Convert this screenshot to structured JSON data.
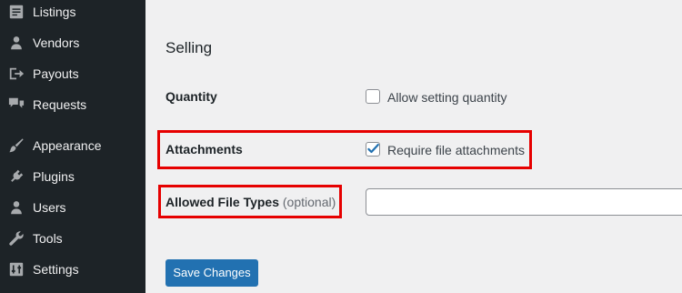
{
  "sidebar": {
    "items": [
      {
        "label": "Listings",
        "icon": "listings-icon"
      },
      {
        "label": "Vendors",
        "icon": "person-icon"
      },
      {
        "label": "Payouts",
        "icon": "payout-arrow-icon"
      },
      {
        "label": "Requests",
        "icon": "chat-bubbles-icon"
      },
      {
        "label": "Appearance",
        "icon": "paintbrush-icon"
      },
      {
        "label": "Plugins",
        "icon": "plug-icon"
      },
      {
        "label": "Users",
        "icon": "person-icon"
      },
      {
        "label": "Tools",
        "icon": "wrench-icon"
      },
      {
        "label": "Settings",
        "icon": "sliders-icon"
      }
    ]
  },
  "main": {
    "section_title": "Selling",
    "quantity": {
      "label": "Quantity",
      "checkbox_label": "Allow setting quantity",
      "checked": false
    },
    "attachments": {
      "label": "Attachments",
      "checkbox_label": "Require file attachments",
      "checked": true
    },
    "allowed_file_types": {
      "label": "Allowed File Types",
      "optional_label": "(optional)",
      "value": "",
      "placeholder": ""
    },
    "save_label": "Save Changes"
  },
  "colors": {
    "sidebar_bg": "#1d2327",
    "sidebar_text": "#f0f0f1",
    "page_bg": "#f0f0f1",
    "primary_button": "#2271b1",
    "highlight": "#e60000"
  }
}
